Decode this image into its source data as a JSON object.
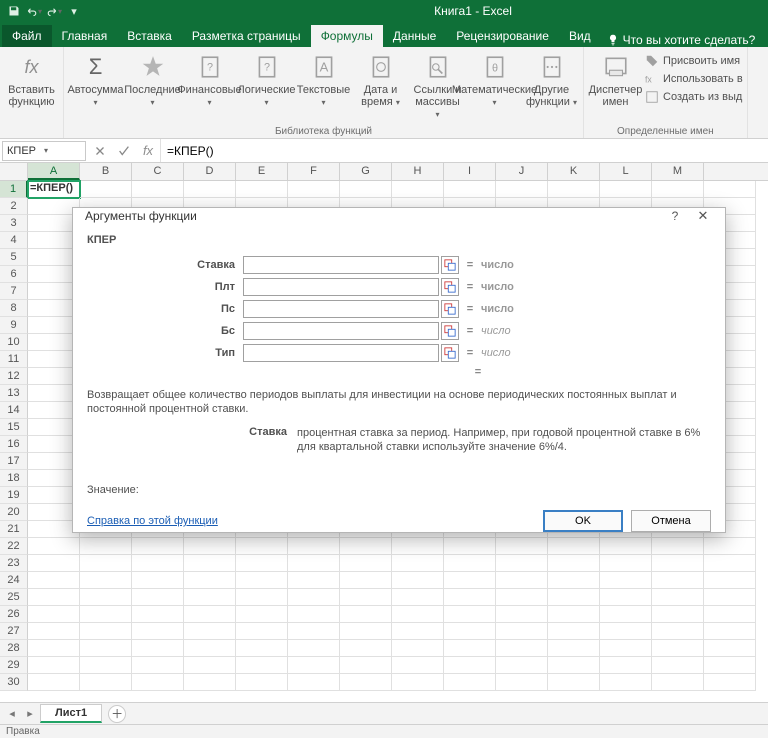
{
  "title": "Книга1 - Excel",
  "tabs": {
    "file": "Файл",
    "t0": "Главная",
    "t1": "Вставка",
    "t2": "Разметка страницы",
    "t3": "Формулы",
    "t4": "Данные",
    "t5": "Рецензирование",
    "t6": "Вид",
    "tell_me": "Что вы хотите сделать?"
  },
  "ribbon": {
    "insert_fn": "Вставить функцию",
    "autosum": "Автосумма",
    "recent": "Последние",
    "financial": "Финансовые",
    "logical": "Логические",
    "text": "Текстовые",
    "datetime": "Дата и время",
    "lookup": "Ссылки и массивы",
    "math": "Математические",
    "more": "Другие функции",
    "lib_label": "Библиотека функций",
    "name_mgr": "Диспетчер имен",
    "assign_name": "Присвоить имя",
    "use_in_fx": "Использовать в",
    "from_sel": "Создать из выд",
    "defined_label": "Определенные имен"
  },
  "namebox": "КПЕР",
  "formula": "=КПЕР()",
  "cols": [
    "A",
    "B",
    "C",
    "D",
    "E",
    "F",
    "G",
    "H",
    "I",
    "J",
    "K",
    "L",
    "M"
  ],
  "rows": [
    "1",
    "2",
    "3",
    "4",
    "5",
    "6",
    "7",
    "8",
    "9",
    "10",
    "11",
    "12",
    "13",
    "14",
    "15",
    "16",
    "17",
    "18",
    "19",
    "20",
    "21",
    "22",
    "23",
    "24",
    "25",
    "26",
    "27",
    "28",
    "29",
    "30"
  ],
  "cell_a1": "=КПЕР()",
  "sheet": {
    "active": "Лист1"
  },
  "status": "Правка",
  "dlg": {
    "title": "Аргументы функции",
    "fn": "КПЕР",
    "args": {
      "a0": "Ставка",
      "a1": "Плт",
      "a2": "Пс",
      "a3": "Бс",
      "a4": "Тип"
    },
    "arg_type": "число",
    "eq": "=",
    "desc": "Возвращает общее количество периодов выплаты для инвестиции на основе периодических постоянных выплат и постоянной процентной ставки.",
    "param_name": "Ставка",
    "param_desc": "процентная ставка за период. Например, при годовой процентной ставке в 6% для квартальной ставки используйте значение 6%/4.",
    "value_label": "Значение:",
    "help": "Справка по этой функции",
    "ok": "OK",
    "cancel": "Отмена"
  }
}
